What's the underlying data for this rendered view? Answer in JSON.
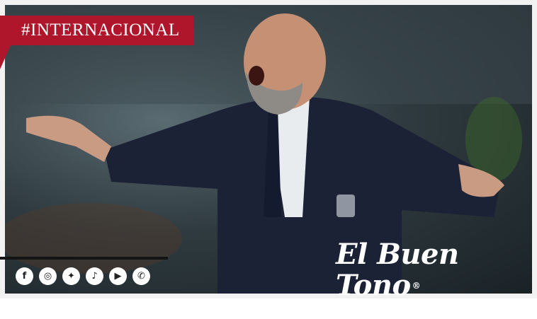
{
  "tag": {
    "label": "#INTERNACIONAL",
    "color": "#b0162b"
  },
  "logo": {
    "name": "El Buen Tono",
    "registered": "®",
    "url": "www.elbuentono.com.mx"
  },
  "social": [
    {
      "name": "facebook-icon",
      "glyph": "f"
    },
    {
      "name": "instagram-icon",
      "glyph": "◎"
    },
    {
      "name": "twitter-icon",
      "glyph": "✦"
    },
    {
      "name": "tiktok-icon",
      "glyph": "♪"
    },
    {
      "name": "youtube-icon",
      "glyph": "▶"
    },
    {
      "name": "whatsapp-icon",
      "glyph": "✆"
    }
  ]
}
